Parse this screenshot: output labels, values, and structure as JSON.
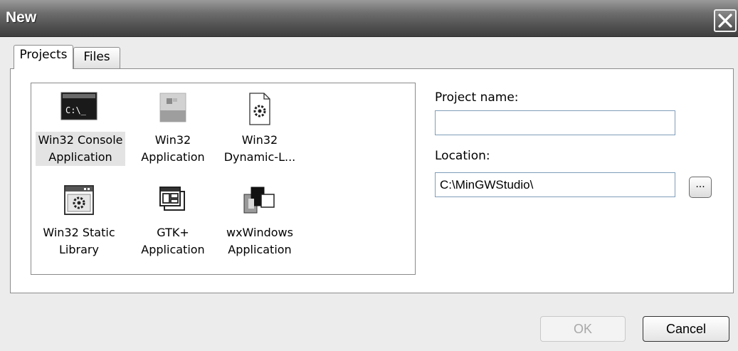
{
  "window": {
    "title": "New",
    "close_label": "Close"
  },
  "tabs": [
    {
      "label": "Projects",
      "selected": true
    },
    {
      "label": "Files",
      "selected": false
    }
  ],
  "project_types": [
    {
      "line1": "Win32 Console",
      "line2": "Application",
      "icon": "console-app-icon",
      "selected": true
    },
    {
      "line1": "Win32",
      "line2": "Application",
      "icon": "win32-app-icon",
      "selected": false
    },
    {
      "line1": "Win32",
      "line2": "Dynamic-L...",
      "icon": "dll-gear-document-icon",
      "selected": false
    },
    {
      "line1": "Win32 Static",
      "line2": "Library",
      "icon": "static-library-icon",
      "selected": false
    },
    {
      "line1": "GTK+",
      "line2": "Application",
      "icon": "gtk-windows-icon",
      "selected": false
    },
    {
      "line1": "wxWindows",
      "line2": "Application",
      "icon": "wxwindows-icon",
      "selected": false
    }
  ],
  "console_icon_text": "C:\\_",
  "form": {
    "project_name_label": "Project name:",
    "project_name_value": "",
    "location_label": "Location:",
    "location_value": "C:\\MinGWStudio\\",
    "browse_label": "..."
  },
  "buttons": {
    "ok": "OK",
    "ok_enabled": false,
    "cancel": "Cancel"
  }
}
